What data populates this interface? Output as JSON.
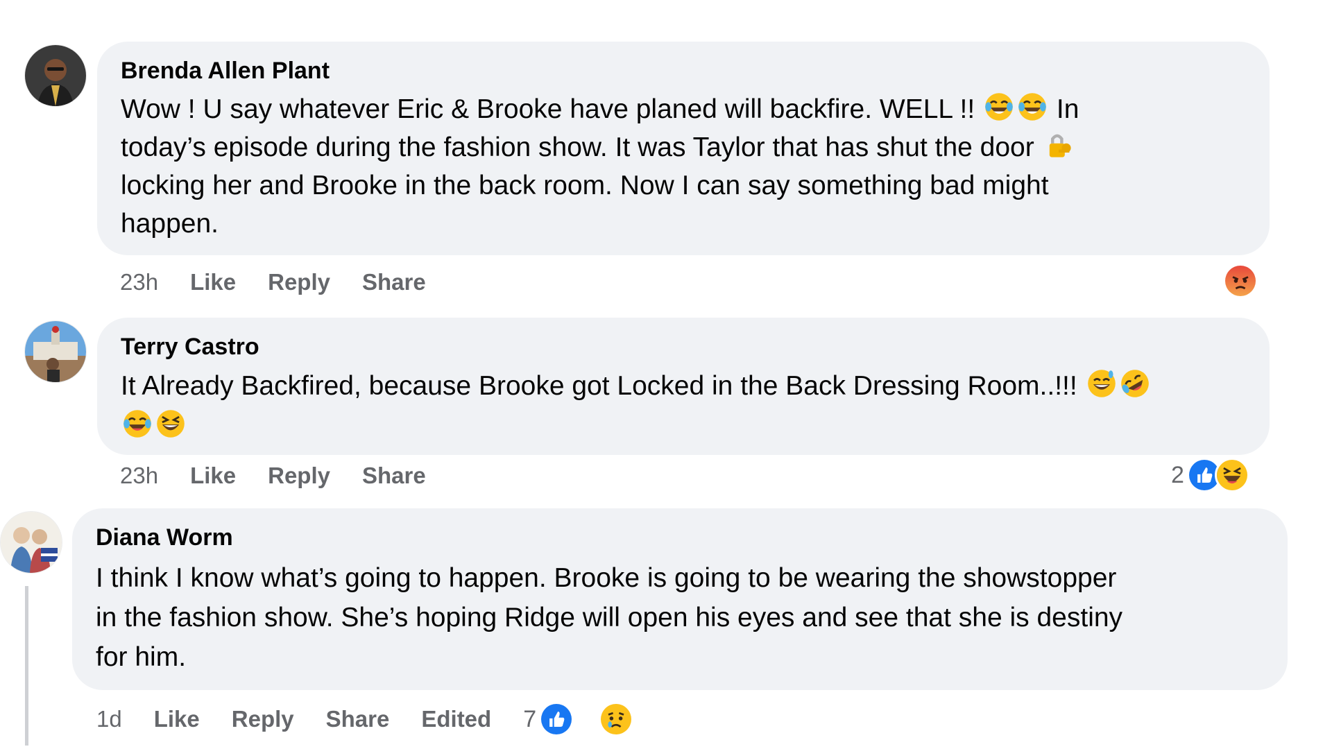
{
  "comments": [
    {
      "author": "Brenda Allen Plant",
      "text_1": "Wow ! U say whatever Eric & Brooke have planed will backfire. WELL !!",
      "text_2": "In",
      "text_3": "today’s episode during the fashion show. It was Taylor that has shut the door",
      "text_4": "locking her and Brooke in the back room. Now I can say something bad might",
      "text_5": "happen.",
      "time": "23h",
      "like": "Like",
      "reply": "Reply",
      "share": "Share",
      "reactions": [
        "angry"
      ]
    },
    {
      "author": "Terry Castro",
      "text_1": "It Already Backfired, because Brooke got Locked in the Back Dressing Room..!!!",
      "time": "23h",
      "like": "Like",
      "reply": "Reply",
      "share": "Share",
      "reaction_count": "2",
      "reactions": [
        "like",
        "haha"
      ]
    },
    {
      "author": "Diana Worm",
      "text_1": "I think I know what’s going to happen. Brooke is going to be wearing the showstopper",
      "text_2": "in the fashion show. She’s hoping Ridge will open his eyes and see that she is destiny",
      "text_3": "for him.",
      "time": "1d",
      "like": "Like",
      "reply": "Reply",
      "share": "Share",
      "edited": "Edited",
      "reaction_count": "7",
      "reactions": [
        "like",
        "sad"
      ]
    }
  ],
  "colors": {
    "bubble": "#f0f2f5",
    "meta": "#65676b",
    "like_blue": "#1877f2",
    "angry": "#e9710f"
  }
}
